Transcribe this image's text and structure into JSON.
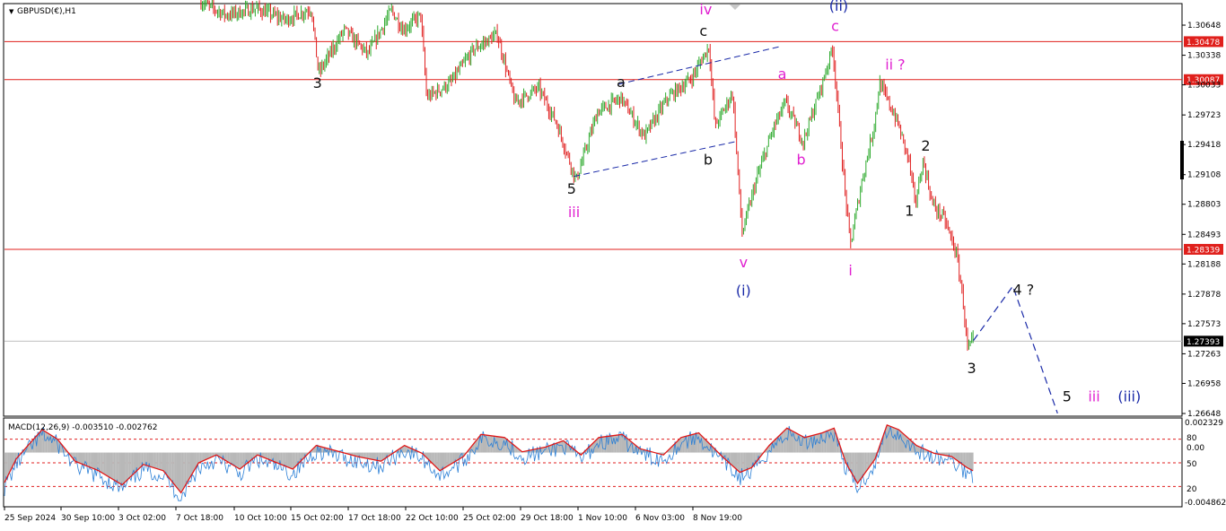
{
  "symbol_label": "GBPUSD(€),H1",
  "indicator_label": "MACD(12,26,9) -0.003510 -0.002762",
  "colors": {
    "bull": "#2eaa2e",
    "bear": "#e02020",
    "hline": "#e0201c",
    "macd": "#2a7fd6",
    "signal": "#e01818",
    "hist": "#b8b8b8",
    "count_black": "#111111",
    "count_magenta": "#e020d0",
    "count_blue": "#1a2aa8",
    "channel": "#1a2aa8"
  },
  "chart_data": [
    {
      "type": "candlestick",
      "symbol": "GBPUSD",
      "timeframe": "H1",
      "y_ticks": [
        "1.30648",
        "1.30338",
        "1.30033",
        "1.29723",
        "1.29418",
        "1.29108",
        "1.28803",
        "1.28493",
        "1.28188",
        "1.27878",
        "1.27573",
        "1.27263",
        "1.26958",
        "1.26648"
      ],
      "ylim": [
        1.26648,
        1.30893
      ],
      "x_ticks": [
        "25 Sep 2024",
        "30 Sep 10:00",
        "3 Oct 02:00",
        "7 Oct 18:00",
        "10 Oct 10:00",
        "15 Oct 02:00",
        "17 Oct 18:00",
        "22 Oct 10:00",
        "25 Oct 02:00",
        "29 Oct 18:00",
        "1 Nov 10:00",
        "6 Nov 03:00",
        "8 Nov 19:00"
      ],
      "price_path": [
        [
          0.167,
          1.3089
        ],
        [
          0.19,
          1.3075
        ],
        [
          0.215,
          1.3082
        ],
        [
          0.24,
          1.307
        ],
        [
          0.262,
          1.3082
        ],
        [
          0.268,
          1.3015
        ],
        [
          0.29,
          1.306
        ],
        [
          0.31,
          1.3035
        ],
        [
          0.33,
          1.308
        ],
        [
          0.34,
          1.306
        ],
        [
          0.355,
          1.3075
        ],
        [
          0.36,
          1.299
        ],
        [
          0.38,
          1.3005
        ],
        [
          0.4,
          1.304
        ],
        [
          0.42,
          1.3055
        ],
        [
          0.435,
          1.2985
        ],
        [
          0.455,
          1.3
        ],
        [
          0.47,
          1.2965
        ],
        [
          0.487,
          1.2905
        ],
        [
          0.505,
          1.2975
        ],
        [
          0.525,
          1.299
        ],
        [
          0.545,
          1.295
        ],
        [
          0.565,
          1.299
        ],
        [
          0.585,
          1.301
        ],
        [
          0.6,
          1.3043
        ],
        [
          0.605,
          1.296
        ],
        [
          0.62,
          1.2995
        ],
        [
          0.628,
          1.285
        ],
        [
          0.64,
          1.2905
        ],
        [
          0.655,
          1.296
        ],
        [
          0.665,
          1.2985
        ],
        [
          0.68,
          1.2945
        ],
        [
          0.695,
          1.3
        ],
        [
          0.705,
          1.3042
        ],
        [
          0.715,
          1.29
        ],
        [
          0.72,
          1.2838
        ],
        [
          0.73,
          1.2905
        ],
        [
          0.74,
          1.296
        ],
        [
          0.745,
          1.3005
        ],
        [
          0.76,
          1.2965
        ],
        [
          0.77,
          1.2925
        ],
        [
          0.775,
          1.288
        ],
        [
          0.782,
          1.2925
        ],
        [
          0.79,
          1.288
        ],
        [
          0.8,
          1.2865
        ],
        [
          0.81,
          1.283
        ],
        [
          0.815,
          1.279
        ],
        [
          0.82,
          1.2728
        ],
        [
          0.8235,
          1.27393
        ]
      ],
      "horizontal_lines": [
        {
          "price": 1.30478,
          "label": "1.30478"
        },
        {
          "price": 1.30087,
          "label": "1.30087"
        },
        {
          "price": 1.28339,
          "label": "1.28339"
        }
      ],
      "current_price": {
        "price": 1.27393,
        "label": "1.27393"
      },
      "channel_lines": [
        [
          [
            0.484,
            1.2909
          ],
          [
            0.622,
            1.2945
          ]
        ],
        [
          [
            0.522,
            1.3004
          ],
          [
            0.66,
            1.3043
          ]
        ]
      ],
      "projection_path": [
        [
          0.8235,
          1.274
        ],
        [
          0.857,
          1.2796
        ],
        [
          0.895,
          1.2665
        ]
      ],
      "wave_labels": [
        {
          "text": "3",
          "x": 0.266,
          "price": 1.30003,
          "color": "black"
        },
        {
          "text": "iv",
          "x": 0.596,
          "price": 1.30758,
          "color": "magenta"
        },
        {
          "text": "c",
          "x": 0.594,
          "price": 1.30538,
          "color": "black"
        },
        {
          "text": "(ii)",
          "x": 0.709,
          "price": 1.30798,
          "color": "blue"
        },
        {
          "text": "c",
          "x": 0.706,
          "price": 1.30588,
          "color": "magenta"
        },
        {
          "text": "a",
          "x": 0.524,
          "price": 1.30013,
          "color": "black"
        },
        {
          "text": "a",
          "x": 0.661,
          "price": 1.30093,
          "color": "magenta"
        },
        {
          "text": "ii ?",
          "x": 0.757,
          "price": 1.30193,
          "color": "magenta"
        },
        {
          "text": "b",
          "x": 0.598,
          "price": 1.29213,
          "color": "black"
        },
        {
          "text": "b",
          "x": 0.677,
          "price": 1.29213,
          "color": "magenta"
        },
        {
          "text": "2",
          "x": 0.783,
          "price": 1.29353,
          "color": "black"
        },
        {
          "text": "5",
          "x": 0.482,
          "price": 1.28913,
          "color": "black"
        },
        {
          "text": "iii",
          "x": 0.484,
          "price": 1.28673,
          "color": "magenta"
        },
        {
          "text": "1",
          "x": 0.769,
          "price": 1.28683,
          "color": "black"
        },
        {
          "text": "v",
          "x": 0.628,
          "price": 1.28153,
          "color": "magenta"
        },
        {
          "text": "i",
          "x": 0.719,
          "price": 1.28073,
          "color": "magenta"
        },
        {
          "text": "(i)",
          "x": 0.628,
          "price": 1.27863,
          "color": "blue"
        },
        {
          "text": "4 ?",
          "x": 0.866,
          "price": 1.27873,
          "color": "black"
        },
        {
          "text": "3",
          "x": 0.822,
          "price": 1.27063,
          "color": "black"
        },
        {
          "text": "5",
          "x": 0.903,
          "price": 1.26773,
          "color": "black"
        },
        {
          "text": "iii",
          "x": 0.926,
          "price": 1.26773,
          "color": "magenta"
        },
        {
          "text": "(iii)",
          "x": 0.956,
          "price": 1.26773,
          "color": "blue"
        }
      ],
      "grid": false
    },
    {
      "type": "line",
      "indicator": "MACD",
      "params": [
        12,
        26,
        9
      ],
      "values": {
        "macd": -0.00351,
        "signal": -0.002762
      },
      "y_ticks": [
        "0.002329",
        "80",
        "0.00",
        "50",
        "20",
        "-0.004862"
      ],
      "ylim": [
        -0.004862,
        0.002329
      ],
      "level_lines": [
        80,
        50,
        20
      ],
      "signal_path": [
        [
          0.0,
          25
        ],
        [
          0.01,
          55
        ],
        [
          0.02,
          72
        ],
        [
          0.032,
          92
        ],
        [
          0.045,
          80
        ],
        [
          0.06,
          52
        ],
        [
          0.08,
          40
        ],
        [
          0.1,
          22
        ],
        [
          0.118,
          48
        ],
        [
          0.135,
          40
        ],
        [
          0.15,
          12
        ],
        [
          0.165,
          50
        ],
        [
          0.18,
          60
        ],
        [
          0.2,
          42
        ],
        [
          0.215,
          60
        ],
        [
          0.245,
          42
        ],
        [
          0.265,
          72
        ],
        [
          0.3,
          58
        ],
        [
          0.32,
          52
        ],
        [
          0.34,
          72
        ],
        [
          0.355,
          62
        ],
        [
          0.37,
          40
        ],
        [
          0.39,
          58
        ],
        [
          0.405,
          86
        ],
        [
          0.425,
          82
        ],
        [
          0.44,
          64
        ],
        [
          0.46,
          70
        ],
        [
          0.475,
          78
        ],
        [
          0.49,
          60
        ],
        [
          0.505,
          82
        ],
        [
          0.525,
          86
        ],
        [
          0.54,
          68
        ],
        [
          0.56,
          60
        ],
        [
          0.575,
          82
        ],
        [
          0.59,
          88
        ],
        [
          0.61,
          58
        ],
        [
          0.625,
          38
        ],
        [
          0.635,
          44
        ],
        [
          0.65,
          72
        ],
        [
          0.665,
          94
        ],
        [
          0.68,
          82
        ],
        [
          0.695,
          88
        ],
        [
          0.705,
          94
        ],
        [
          0.715,
          50
        ],
        [
          0.725,
          24
        ],
        [
          0.74,
          55
        ],
        [
          0.75,
          98
        ],
        [
          0.76,
          92
        ],
        [
          0.775,
          72
        ],
        [
          0.79,
          62
        ],
        [
          0.805,
          58
        ],
        [
          0.818,
          44
        ],
        [
          0.823,
          40
        ]
      ]
    }
  ]
}
